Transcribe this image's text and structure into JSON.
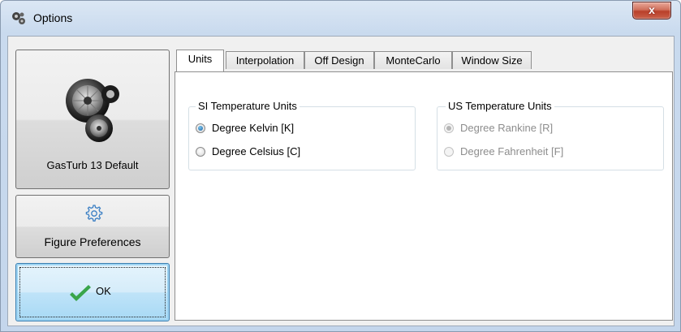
{
  "window": {
    "title": "Options",
    "close_label": "x"
  },
  "sidebar": {
    "default_button": "GasTurb 13 Default",
    "figure_button": "Figure Preferences",
    "ok_button": "OK"
  },
  "tabs": [
    {
      "label": "Units",
      "active": true
    },
    {
      "label": "Interpolation",
      "active": false
    },
    {
      "label": "Off Design",
      "active": false
    },
    {
      "label": "MonteCarlo",
      "active": false
    },
    {
      "label": "Window Size",
      "active": false
    }
  ],
  "si_group": {
    "legend": "SI Temperature Units",
    "options": [
      {
        "label": "Degree Kelvin  [K]",
        "checked": true
      },
      {
        "label": "Degree Celsius [C]",
        "checked": false
      }
    ]
  },
  "us_group": {
    "legend": "US Temperature Units",
    "disabled": true,
    "options": [
      {
        "label": "Degree Rankine   [R]",
        "checked": true
      },
      {
        "label": "Degree Fahrenheit [F]",
        "checked": false
      }
    ]
  },
  "colors": {
    "ok_check": "#3aa54a",
    "gear_icon": "#3b7fc4",
    "accent": "#3c7fb1"
  }
}
